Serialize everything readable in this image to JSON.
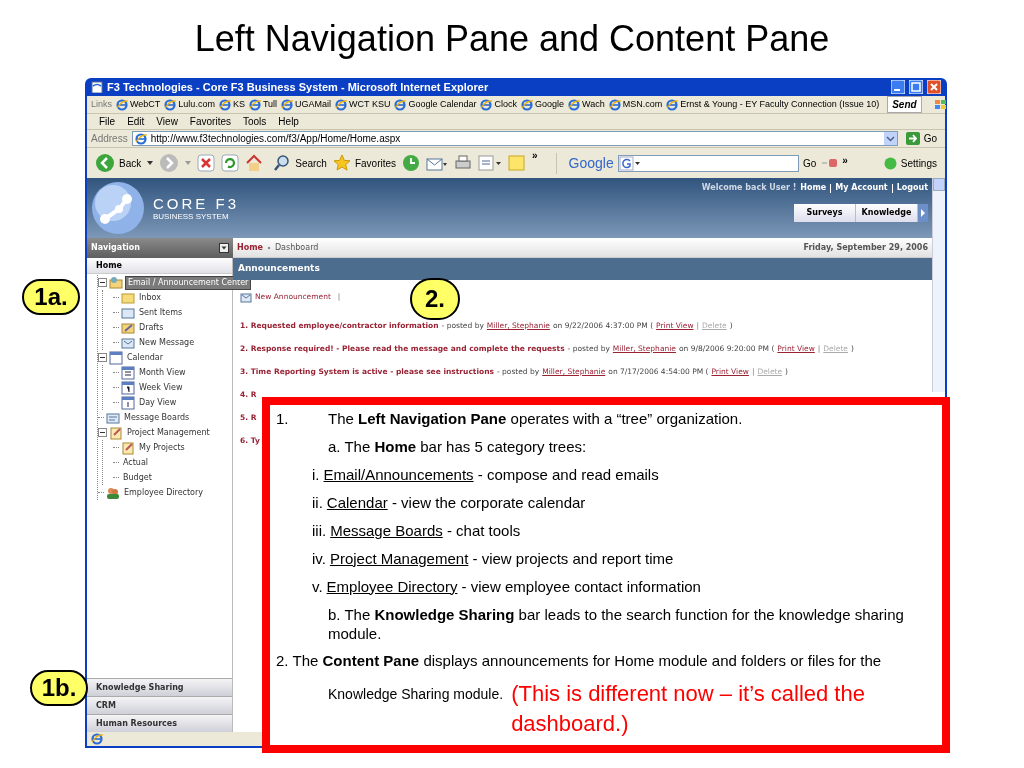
{
  "slide_title": "Left Navigation Pane and Content Pane",
  "browser": {
    "title": "F3 Technologies - Core F3 Business System - Microsoft Internet Explorer",
    "links_label": "Links",
    "links": [
      "WebCT",
      "Lulu.com",
      "KS",
      "Tull",
      "UGAMail",
      "WCT KSU",
      "Google Calendar",
      "Clock",
      "Google",
      "Wach",
      "MSN.com",
      "Ernst & Young - EY Faculty Connection (Issue 10)"
    ],
    "send": "Send",
    "menu": [
      "File",
      "Edit",
      "View",
      "Favorites",
      "Tools",
      "Help"
    ],
    "address": {
      "label": "Address",
      "url": "http://www.f3technologies.com/f3/App/Home/Home.aspx",
      "go": "Go"
    },
    "toolbar": {
      "back": "Back",
      "search": "Search",
      "favorites": "Favorites",
      "more": "»",
      "google": "Google",
      "google_go": "Go",
      "google_more": "»",
      "settings": "Settings"
    }
  },
  "page": {
    "logo": {
      "name": "CORE F3",
      "tagline": "BUSINESS SYSTEM"
    },
    "welcome": "Welcome back User !",
    "top_links": [
      "Home",
      "My Account",
      "Logout"
    ],
    "tabs": [
      "Surveys",
      "Knowledge"
    ],
    "nav_title": "Navigation",
    "breadcrumb": [
      "Home",
      "Dashboard"
    ],
    "date": "Friday, September 29, 2006",
    "nav_section": "Home",
    "tree": [
      {
        "label": "Email / Announcement Center",
        "selected": true,
        "expanded": true,
        "children": [
          {
            "label": "Inbox",
            "selected": false
          },
          {
            "label": "Sent Items",
            "selected": false
          },
          {
            "label": "Drafts",
            "selected": false
          },
          {
            "label": "New Message",
            "selected": false
          }
        ]
      },
      {
        "label": "Calendar",
        "selected": false,
        "expanded": true,
        "children": [
          {
            "label": "Month View",
            "selected": false
          },
          {
            "label": "Week View",
            "selected": false
          },
          {
            "label": "Day View",
            "selected": false
          }
        ]
      },
      {
        "label": "Message Boards",
        "selected": false
      },
      {
        "label": "Project Management",
        "selected": false,
        "expanded": true,
        "children": [
          {
            "label": "My Projects",
            "selected": false
          },
          {
            "label": "Actual",
            "selected": false
          },
          {
            "label": "Budget",
            "selected": false
          }
        ]
      },
      {
        "label": "Employee Directory",
        "selected": false
      }
    ],
    "bottom_bars": [
      "Knowledge Sharing",
      "CRM",
      "Human Resources"
    ],
    "content_title": "Announcements",
    "new_announcement": "New Announcement",
    "action_sep": "|",
    "announcements": [
      {
        "title": "1. Requested employee/contractor information",
        "byline": "- posted by",
        "author": "Miller, Stephanie",
        "when": "on 9/22/2006 4:37:00 PM (",
        "print": "Print View",
        "sep": "|",
        "delete": "Delete",
        "close": ")"
      },
      {
        "title": "2. Response required! - Please read the message and complete the requests",
        "byline": "- posted by",
        "author": "Miller, Stephanie",
        "when": "on 9/8/2006 9:20:00 PM (",
        "print": "Print View",
        "sep": "|",
        "delete": "Delete",
        "close": ")"
      },
      {
        "title": "3. Time Reporting System is active - please see instructions",
        "byline": "- posted by",
        "author": "Miller, Stephanie",
        "when": "on 7/17/2006 4:54:00 PM (",
        "print": "Print View",
        "sep": "|",
        "delete": "Delete",
        "close": ")"
      },
      {
        "title": "4. R"
      },
      {
        "title": "5. R"
      },
      {
        "title": "6. Ty"
      }
    ]
  },
  "callouts": [
    "1a.",
    "1b.",
    "2."
  ],
  "note": [
    {
      "kind": "numbered",
      "marker": "1.",
      "text": "The **Left Navigation Pane** operates with a “tree” organization."
    },
    {
      "kind": "sub",
      "text": "a. The **Home** bar has 5 category trees:"
    },
    {
      "kind": "roman",
      "marker": "i.",
      "link": "Email/Announcements",
      "text": "- compose and read emails"
    },
    {
      "kind": "roman",
      "marker": "ii.",
      "link": "Calendar",
      "text": "- view the corporate calendar"
    },
    {
      "kind": "roman",
      "marker": "iii.",
      "link": "Message Boards",
      "text": "- chat tools"
    },
    {
      "kind": "roman",
      "marker": "iv.",
      "link": "Project Management",
      "text": "- view projects and report time"
    },
    {
      "kind": "roman",
      "marker": "v.",
      "link": "Employee Directory",
      "text": "- view employee contact information"
    },
    {
      "kind": "sub",
      "text": "b. The **Knowledge Sharing** bar leads to the search function for the knowledge sharing module."
    },
    {
      "kind": "closing",
      "marker": "2.",
      "text": "The **Content Pane** displays announcements for Home module and folders or files for the",
      "text_2": "Knowledge Sharing module.",
      "remark": "(This is different now – it’s called the dashboard.)"
    }
  ]
}
